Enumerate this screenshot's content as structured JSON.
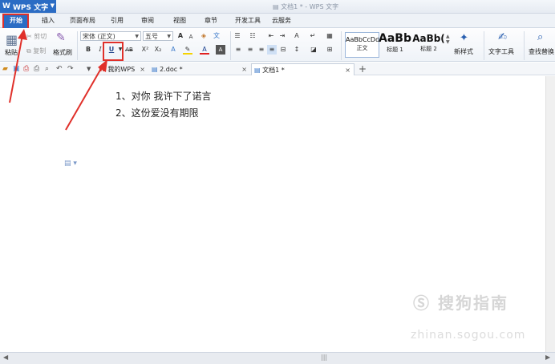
{
  "app": {
    "menu_label": "WPS 文字",
    "logo_letter": "W",
    "window_title": "文档1 * - WPS 文字"
  },
  "ribbon_tabs": [
    "开始",
    "插入",
    "页面布局",
    "引用",
    "审阅",
    "视图",
    "章节",
    "开发工具",
    "云服务"
  ],
  "clipboard": {
    "paste": "粘贴",
    "cut": "剪切",
    "copy": "复制",
    "format_painter": "格式刷"
  },
  "font": {
    "name": "宋体 (正文)",
    "size": "五号",
    "bold": "B",
    "italic": "I",
    "underline": "U",
    "strike": "AB",
    "superscript": "X²",
    "subscript": "X₂",
    "font_color": "A"
  },
  "styles": [
    {
      "preview": "AaBbCcDd",
      "label": "正文"
    },
    {
      "preview": "AaBb",
      "label": "标题 1"
    },
    {
      "preview": "AaBb(",
      "label": "标题 2"
    }
  ],
  "tools": {
    "new_style": "新样式",
    "text_tools": "文字工具",
    "find_replace": "查找替换"
  },
  "doc_tabs": [
    {
      "label": "我的WPS"
    },
    {
      "label": "2.doc *"
    },
    {
      "label": "文档1 *"
    }
  ],
  "document": {
    "lines": [
      "1、对你  我许下了诺言",
      "2、这份爱没有期限"
    ]
  },
  "watermark": {
    "brand": "搜狗指南",
    "url": "zhinan.sogou.com"
  },
  "colors": {
    "accent": "#2b6cc4",
    "annotation": "#e0302a"
  }
}
